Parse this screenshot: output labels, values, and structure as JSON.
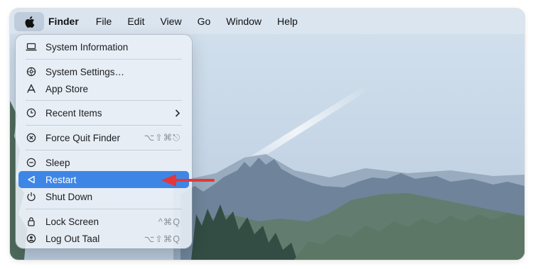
{
  "menubar": {
    "apple_icon": "apple-logo-icon",
    "items": [
      "Finder",
      "File",
      "Edit",
      "View",
      "Go",
      "Window",
      "Help"
    ]
  },
  "apple_menu": {
    "items": [
      {
        "label": "System Information",
        "icon": "laptop-icon",
        "shortcut": ""
      },
      {
        "label": "System Settings…",
        "icon": "settings-gear-icon",
        "shortcut": ""
      },
      {
        "label": "App Store",
        "icon": "app-store-icon",
        "shortcut": ""
      },
      {
        "label": "Recent Items",
        "icon": "clock-icon",
        "shortcut": "",
        "submenu": true
      },
      {
        "label": "Force Quit Finder",
        "icon": "force-quit-icon",
        "shortcut": "⌥⇧⌘⎋"
      },
      {
        "label": "Sleep",
        "icon": "sleep-icon",
        "shortcut": ""
      },
      {
        "label": "Restart",
        "icon": "restart-icon",
        "shortcut": "",
        "highlighted": true
      },
      {
        "label": "Shut Down",
        "icon": "power-icon",
        "shortcut": ""
      },
      {
        "label": "Lock Screen",
        "icon": "lock-icon",
        "shortcut": "^⌘Q"
      },
      {
        "label": "Log Out Taal",
        "icon": "user-icon",
        "shortcut": "⌥⇧⌘Q"
      }
    ]
  },
  "colors": {
    "highlight": "#3e86e6",
    "annotation_arrow": "#e5363a",
    "menu_text": "#1d1d1f"
  }
}
